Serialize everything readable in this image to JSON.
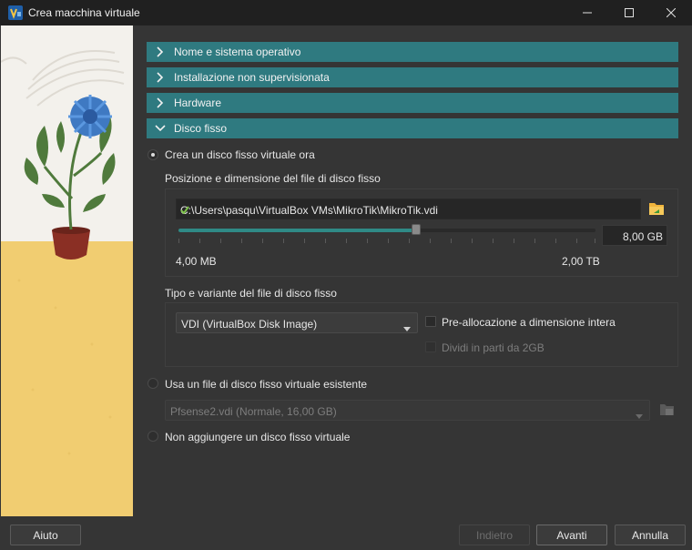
{
  "window": {
    "title": "Crea macchina virtuale",
    "controls": [
      "minimize-icon",
      "maximize-icon",
      "close-icon"
    ]
  },
  "sections": [
    {
      "label": "Nome e sistema operativo",
      "expanded": false
    },
    {
      "label": "Installazione non supervisionata",
      "expanded": false
    },
    {
      "label": "Hardware",
      "expanded": false
    },
    {
      "label": "Disco fisso",
      "expanded": true
    }
  ],
  "disk": {
    "option_create": "Crea un disco fisso virtuale ora",
    "location_group_label": "Posizione e dimensione del file di disco fisso",
    "path_value": "C:\\Users\\pasqu\\VirtualBox VMs\\MikroTik\\MikroTik.vdi",
    "size_value": "8,00 GB",
    "size_fraction": 0.57,
    "slider_min_label": "4,00 MB",
    "slider_max_label": "2,00 TB",
    "type_group_label": "Tipo e variante del file di disco fisso",
    "type_selected": "VDI (VirtualBox Disk Image)",
    "prealloc_label": "Pre-allocazione a dimensione intera",
    "split_label": "Dividi in parti da 2GB",
    "option_existing": "Usa un file di disco fisso virtuale esistente",
    "existing_selected": "Pfsense2.vdi (Normale, 16,00 GB)",
    "option_none": "Non aggiungere un disco fisso virtuale"
  },
  "buttons": {
    "help": "Aiuto",
    "back": "Indietro",
    "next": "Avanti",
    "cancel": "Annulla"
  },
  "colors": {
    "section_header": "#2f7a80",
    "slider_fill": "#2f8a86",
    "valid_check": "#7ec24a",
    "folder_icon": "#f0b43c"
  }
}
